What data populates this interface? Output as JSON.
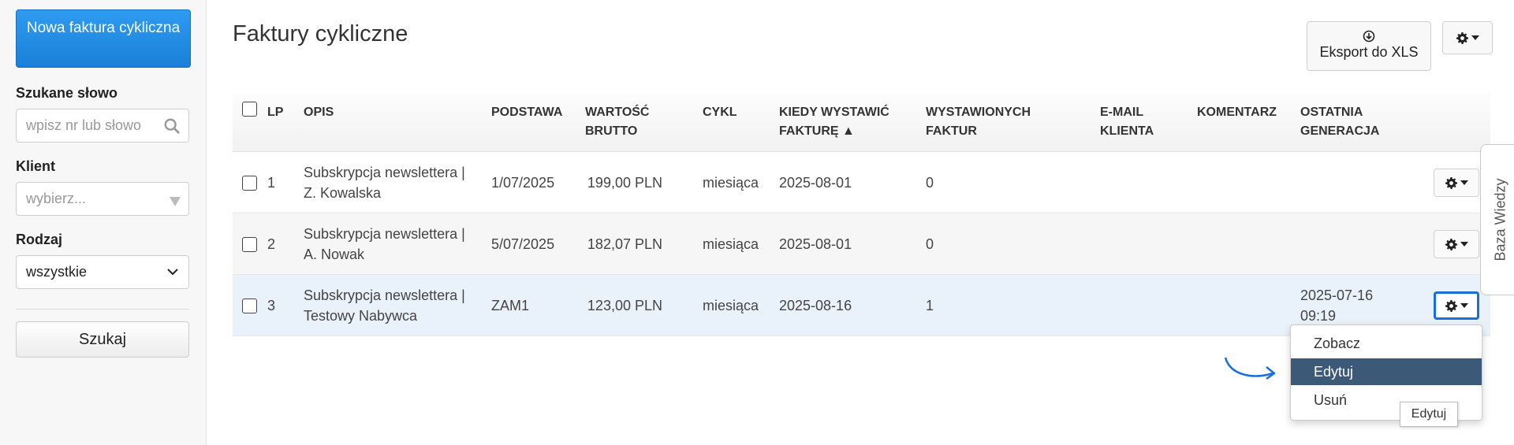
{
  "sidebar": {
    "new_button": "Nowa faktura cykliczna",
    "search_label": "Szukane słowo",
    "search_placeholder": "wpisz nr lub słowo",
    "client_label": "Klient",
    "client_placeholder": "wybierz...",
    "type_label": "Rodzaj",
    "type_value": "wszystkie",
    "search_button": "Szukaj"
  },
  "header": {
    "title": "Faktury cykliczne",
    "export_button": "Eksport do XLS"
  },
  "table": {
    "columns": {
      "lp": "LP",
      "opis": "OPIS",
      "podstawa": "PODSTAWA",
      "wartosc_1": "WARTOŚĆ",
      "wartosc_2": "BRUTTO",
      "cykl": "CYKL",
      "kiedy_1": "KIEDY WYSTAWIĆ",
      "kiedy_2": "FAKTURĘ ▲",
      "wystawionych_1": "WYSTAWIONYCH",
      "wystawionych_2": "FAKTUR",
      "email_1": "E-MAIL",
      "email_2": "KLIENTA",
      "komentarz": "KOMENTARZ",
      "ostatnia_1": "OSTATNIA",
      "ostatnia_2": "GENERACJA"
    },
    "rows": [
      {
        "lp": "1",
        "opis_1": "Subskrypcja newslettera |",
        "opis_2": "Z. Kowalska",
        "podstawa": "1/07/2025",
        "wartosc": "199,00 PLN",
        "cykl": "miesiąca",
        "kiedy": "2025-08-01",
        "wystawionych": "0",
        "email": "",
        "komentarz": "",
        "ostatnia_1": "",
        "ostatnia_2": ""
      },
      {
        "lp": "2",
        "opis_1": "Subskrypcja newslettera |",
        "opis_2": "A. Nowak",
        "podstawa": "5/07/2025",
        "wartosc": "182,07 PLN",
        "cykl": "miesiąca",
        "kiedy": "2025-08-01",
        "wystawionych": "0",
        "email": "",
        "komentarz": "",
        "ostatnia_1": "",
        "ostatnia_2": ""
      },
      {
        "lp": "3",
        "opis_1": "Subskrypcja newslettera |",
        "opis_2": "Testowy Nabywca",
        "podstawa": "ZAM1",
        "wartosc": "123,00 PLN",
        "cykl": "miesiąca",
        "kiedy": "2025-08-16",
        "wystawionych": "1",
        "email": "",
        "komentarz": "",
        "ostatnia_1": "2025-07-16",
        "ostatnia_2": "09:19"
      }
    ]
  },
  "dropdown": {
    "items": [
      "Zobacz",
      "Edytuj",
      "Usuń"
    ],
    "active": "Edytuj",
    "tooltip": "Edytuj"
  },
  "side_tab": "Baza Wiedzy",
  "colors": {
    "primary_button": "#1a7fd8",
    "active_menu": "#3c5a78",
    "focus_outline": "#1a6fd8",
    "row_highlight": "#e9f1fa"
  }
}
